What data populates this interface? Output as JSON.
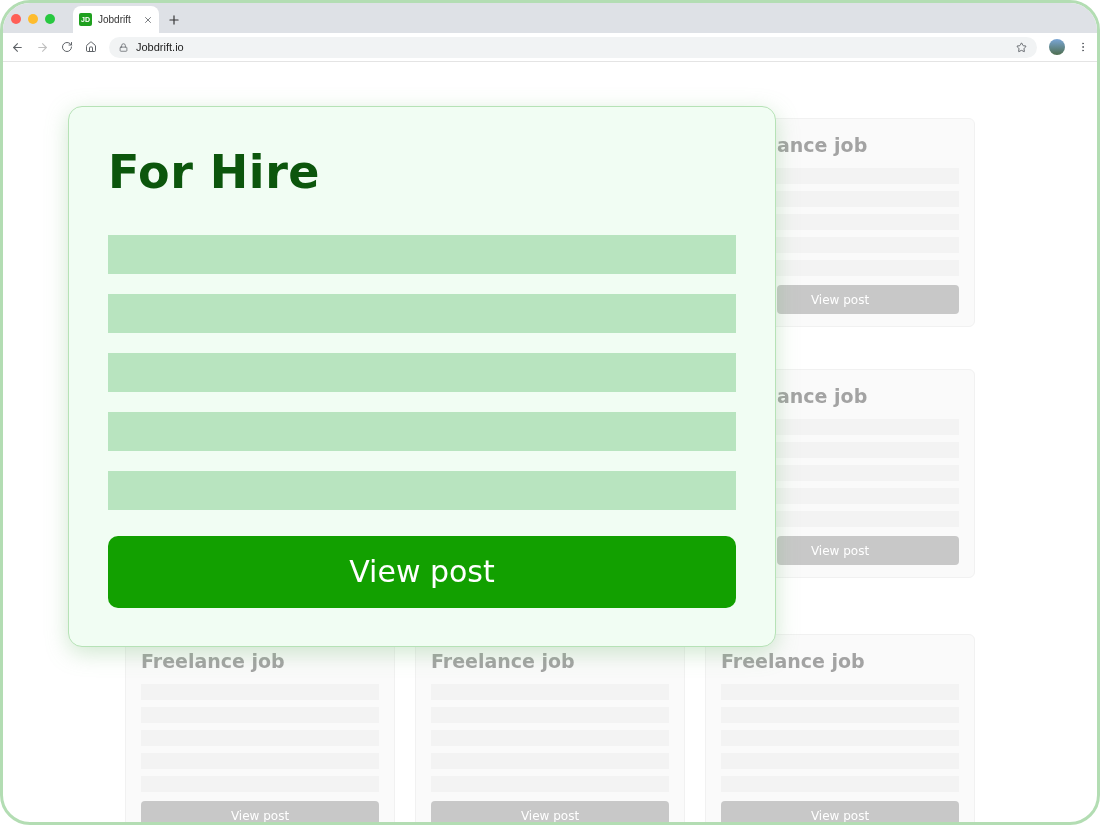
{
  "browser": {
    "tab": {
      "favicon_text": "JD",
      "title": "Jobdrift",
      "selected": true
    },
    "address": "Jobdrift.io",
    "forward_disabled": true
  },
  "listing": {
    "rows": [
      {
        "cards": [
          {
            "kind": "clipped",
            "title": "ance job",
            "button": "View post"
          }
        ]
      },
      {
        "cards": [
          {
            "kind": "clipped",
            "title": "ance job",
            "button": "View post"
          }
        ]
      },
      {
        "cards": [
          {
            "kind": "full",
            "title": "Freelance job",
            "button": "View post"
          },
          {
            "kind": "full",
            "title": "Freelance job",
            "button": "View post"
          },
          {
            "kind": "full",
            "title": "Freelance job",
            "button": "View post"
          }
        ]
      }
    ]
  },
  "featured": {
    "title": "For Hire",
    "button": "View post"
  }
}
